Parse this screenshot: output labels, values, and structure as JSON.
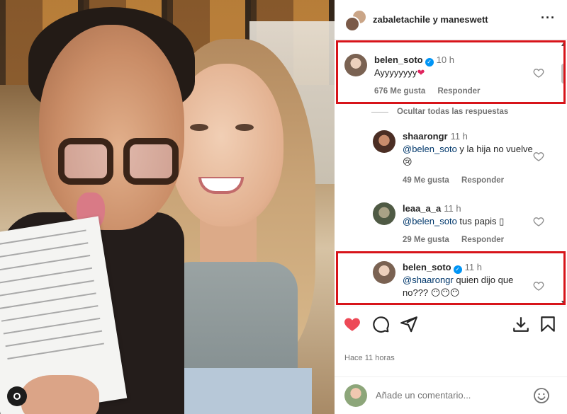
{
  "header": {
    "user1": "zabaletachile",
    "conjunction": "y",
    "user2": "maneswett",
    "more_icon": "more-horizontal-icon"
  },
  "comments": [
    {
      "username": "belen_soto",
      "verified": true,
      "time": "10 h",
      "text": "Ayyyyyyyy",
      "emoji": "❤",
      "likes": "676 Me gusta",
      "reply": "Responder",
      "highlighted": true
    },
    {
      "username": "shaarongr",
      "verified": false,
      "time": "11 h",
      "mention": "@belen_soto",
      "text": " y la hija no vuelve",
      "emoji": "😢",
      "likes": "49 Me gusta",
      "reply": "Responder"
    },
    {
      "username": "leaa_a_a",
      "verified": false,
      "time": "11 h",
      "mention": "@belen_soto",
      "text": " tus papis",
      "emoji": "▯",
      "likes": "29 Me gusta",
      "reply": "Responder"
    },
    {
      "username": "belen_soto",
      "verified": true,
      "time": "11 h",
      "mention": "@shaarongr",
      "text": " quien dijo que no???",
      "emoji": "😶😶😶",
      "highlighted": true
    }
  ],
  "hide_replies": "Ocultar todas las respuestas",
  "time_ago": "Hace 11 horas",
  "add_comment": {
    "placeholder": "Añade un comentario..."
  },
  "colors": {
    "highlight": "#d7141a",
    "like": "#ed4956",
    "verified": "#0095f6"
  }
}
